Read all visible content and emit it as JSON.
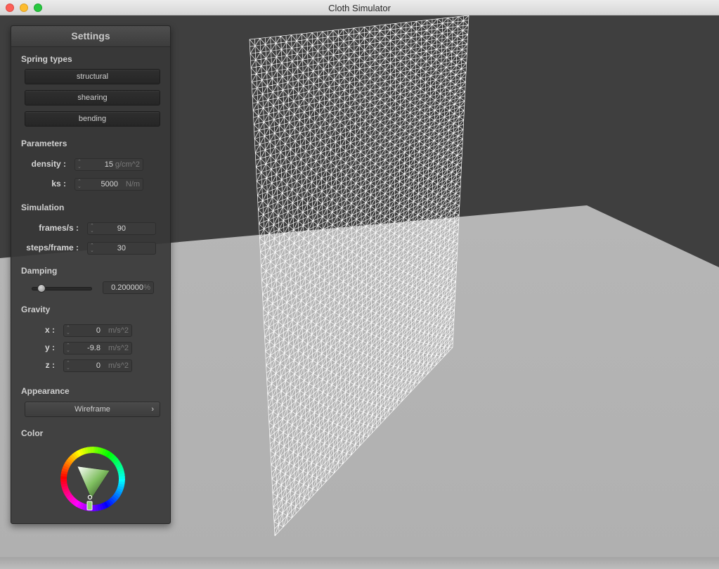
{
  "window": {
    "title": "Cloth Simulator"
  },
  "settings": {
    "title": "Settings",
    "spring_types": {
      "label": "Spring types",
      "buttons": [
        {
          "label": "structural"
        },
        {
          "label": "shearing"
        },
        {
          "label": "bending"
        }
      ]
    },
    "parameters": {
      "label": "Parameters",
      "density": {
        "label": "density :",
        "value": "15",
        "unit": "g/cm^2"
      },
      "ks": {
        "label": "ks :",
        "value": "5000",
        "unit": "N/m"
      }
    },
    "simulation": {
      "label": "Simulation",
      "frames_per_sec": {
        "label": "frames/s :",
        "value": "90"
      },
      "steps_per_frame": {
        "label": "steps/frame :",
        "value": "30"
      }
    },
    "damping": {
      "label": "Damping",
      "value": "0.200000",
      "unit": "%",
      "slider_fraction": 0.2
    },
    "gravity": {
      "label": "Gravity",
      "x": {
        "label": "x :",
        "value": "0",
        "unit": "m/s^2"
      },
      "y": {
        "label": "y :",
        "value": "-9.8",
        "unit": "m/s^2"
      },
      "z": {
        "label": "z :",
        "value": "0",
        "unit": "m/s^2"
      }
    },
    "appearance": {
      "label": "Appearance",
      "selected": "Wireframe",
      "chevron_icon": "chevron-right-icon"
    },
    "color": {
      "label": "Color",
      "selected_hue": "#7fbf5f"
    }
  },
  "scene": {
    "render_mode": "Wireframe",
    "background_color": "#3f3f3f",
    "floor_color": "#b3b3b3",
    "cloth_color": "#ffffff"
  }
}
